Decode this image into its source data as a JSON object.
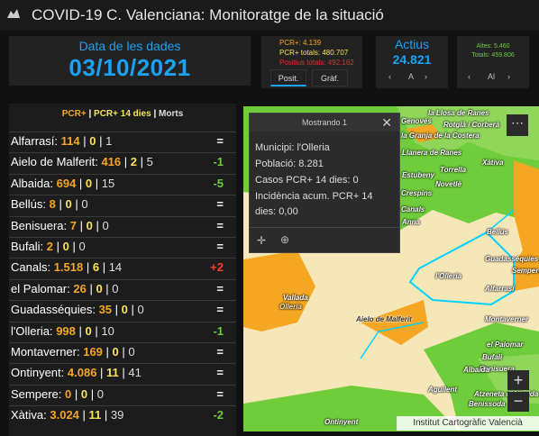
{
  "header": {
    "title": "COVID-19 C. Valenciana: Monitoratge de la situació"
  },
  "date_panel": {
    "label": "Data de les dades",
    "value": "03/10/2021"
  },
  "pcr_panel": {
    "pcr_plus": "PCR+: 4.139",
    "pcr_totals": "PCR+ totals: 480.707",
    "positius_totals": "Positius totals: 492.162",
    "tabs": [
      "Posit.",
      "Gràf."
    ]
  },
  "actius_panel": {
    "label": "Actius",
    "value": "24.821",
    "pager_text": "A",
    "prev_icon": "chevron-left",
    "next_icon": "chevron-right"
  },
  "altes_panel": {
    "altes": "Altes: 5.460",
    "totals": "Totals: 459.806",
    "pager_text": "Al",
    "prev_icon": "chevron-left",
    "next_icon": "chevron-right"
  },
  "list": {
    "header": {
      "pcr": "PCR+",
      "sep": " | ",
      "pcr14": "PCR+ 14 dies",
      "sep2": " | ",
      "morts": "Morts"
    },
    "rows": [
      {
        "name": "Alfarrasí:",
        "pcr": "114",
        "p14": "0",
        "mort": "1",
        "trend": "="
      },
      {
        "name": "Aielo de Malferit:",
        "pcr": "416",
        "p14": "2",
        "mort": "5",
        "trend": "-1"
      },
      {
        "name": "Albaida:",
        "pcr": "694",
        "p14": "0",
        "mort": "15",
        "trend": "-5"
      },
      {
        "name": "Bellús:",
        "pcr": "8",
        "p14": "0",
        "mort": "0",
        "trend": "="
      },
      {
        "name": "Benisuera:",
        "pcr": "7",
        "p14": "0",
        "mort": "0",
        "trend": "="
      },
      {
        "name": "Bufali:",
        "pcr": "2",
        "p14": "0",
        "mort": "0",
        "trend": "="
      },
      {
        "name": "Canals:",
        "pcr": "1.518",
        "p14": "6",
        "mort": "14",
        "trend": "+2"
      },
      {
        "name": "el Palomar:",
        "pcr": "26",
        "p14": "0",
        "mort": "0",
        "trend": "="
      },
      {
        "name": "Guadasséquies:",
        "pcr": "35",
        "p14": "0",
        "mort": "0",
        "trend": "="
      },
      {
        "name": "l'Olleria:",
        "pcr": "998",
        "p14": "0",
        "mort": "10",
        "trend": "-1"
      },
      {
        "name": "Montaverner:",
        "pcr": "169",
        "p14": "0",
        "mort": "0",
        "trend": "="
      },
      {
        "name": "Ontinyent:",
        "pcr": "4.086",
        "p14": "11",
        "mort": "41",
        "trend": "="
      },
      {
        "name": "Sempere:",
        "pcr": "0",
        "p14": "0",
        "mort": "0",
        "trend": "="
      },
      {
        "name": "Xàtiva:",
        "pcr": "3.024",
        "p14": "11",
        "mort": "39",
        "trend": "-2"
      }
    ]
  },
  "popup": {
    "title": "Mostrando 1",
    "lines": [
      "Municipi: l'Olleria",
      "Població: 8.281",
      "Casos PCR+ 14 dies: 0",
      "Incidència acum. PCR+ 14",
      "dies: 0,00"
    ]
  },
  "map": {
    "attribution": "Institut Cartogràfic Valencià",
    "labels": [
      "la Llosa de Ranes",
      "Genovés",
      "la Granja de la Costera",
      "Rotglà i Corberà",
      "Llanera de Ranes",
      "Xàtiva",
      "Torrella",
      "Novetlè",
      "Estubeny",
      "Crespins",
      "Canals",
      "Anna",
      "Bellús",
      "Guadasséquies",
      "Sempere",
      "l'Olleria",
      "Alfarrasí",
      "Vallada",
      "Aielo de Malferit",
      "Montaverner",
      "el Palomar",
      "Bufali",
      "Benisuera",
      "Albaida",
      "Atzeneta d'Albaida",
      "Aguilent",
      "Benissoda",
      "Ontinyent",
      "Ollería"
    ],
    "colors": {
      "green": "#6fcc3a",
      "orange": "#f5a623",
      "cream": "#f6e7b8",
      "boundary": "#00d2ff"
    }
  },
  "colors": {
    "accent_blue": "#1da1f2",
    "pcr_orange": "#f5a623",
    "pcr14_yellow": "#f7e35a",
    "trend_green": "#6fcc3a",
    "trend_red": "#ff3b30"
  }
}
